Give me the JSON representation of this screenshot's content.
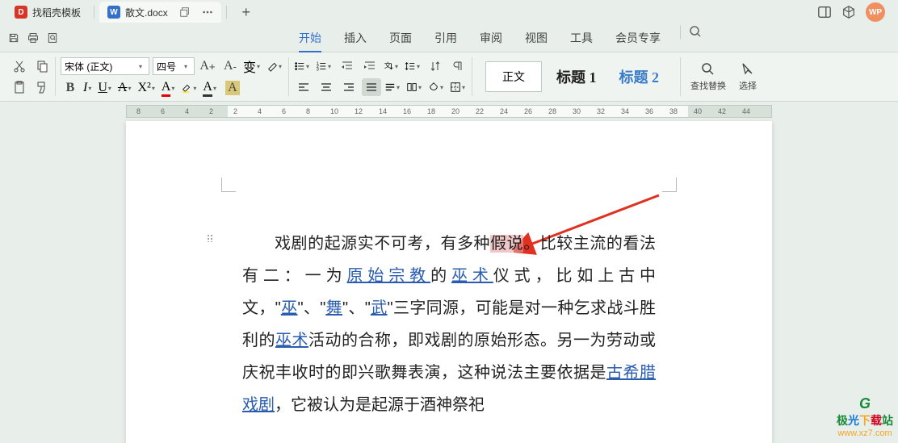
{
  "tabs": [
    {
      "icon": "D",
      "label": "找稻壳模板"
    },
    {
      "icon": "W",
      "label": "散文.docx"
    }
  ],
  "avatar_text": "WP",
  "menu": {
    "items": [
      "开始",
      "插入",
      "页面",
      "引用",
      "审阅",
      "视图",
      "工具",
      "会员专享"
    ],
    "active_index": 0
  },
  "font": {
    "name": "宋体 (正文)",
    "size": "四号"
  },
  "styles": {
    "normal": "正文",
    "h1": "标题 1",
    "h2": "标题 2"
  },
  "right_tools": {
    "find_replace": "查找替换",
    "select": "选择"
  },
  "ruler_numbers": [
    8,
    6,
    4,
    2,
    2,
    4,
    6,
    8,
    10,
    12,
    14,
    16,
    18,
    20,
    22,
    24,
    26,
    28,
    30,
    32,
    34,
    36,
    38,
    40,
    42,
    44
  ],
  "doc": {
    "t1a": "戏剧的起源实不可考，有多种",
    "highlight": "假说",
    "t1b": "。比较主流的看法有二：一为",
    "link1": "原始宗教",
    "t2a": "的",
    "link2": "巫术",
    "t2b": "仪式，比如上古中文，\"",
    "link3": "巫",
    "t2c": "\"、\"",
    "link4": "舞",
    "t2d": "\"、\"",
    "link5": "武",
    "t2e": "\"三字同源，可能是对一种乞求战斗胜利的",
    "link6": "巫术",
    "t3a": "活动的合称，即戏剧的原始形态。另一为劳动或庆祝丰收时的即兴歌舞表演，这种说法主要依据是",
    "link7": "古希腊戏剧",
    "t4a": "，它被认为是起源于酒神祭祀"
  },
  "watermark": {
    "site": "极光下载站",
    "url": "www.xz7.com"
  }
}
